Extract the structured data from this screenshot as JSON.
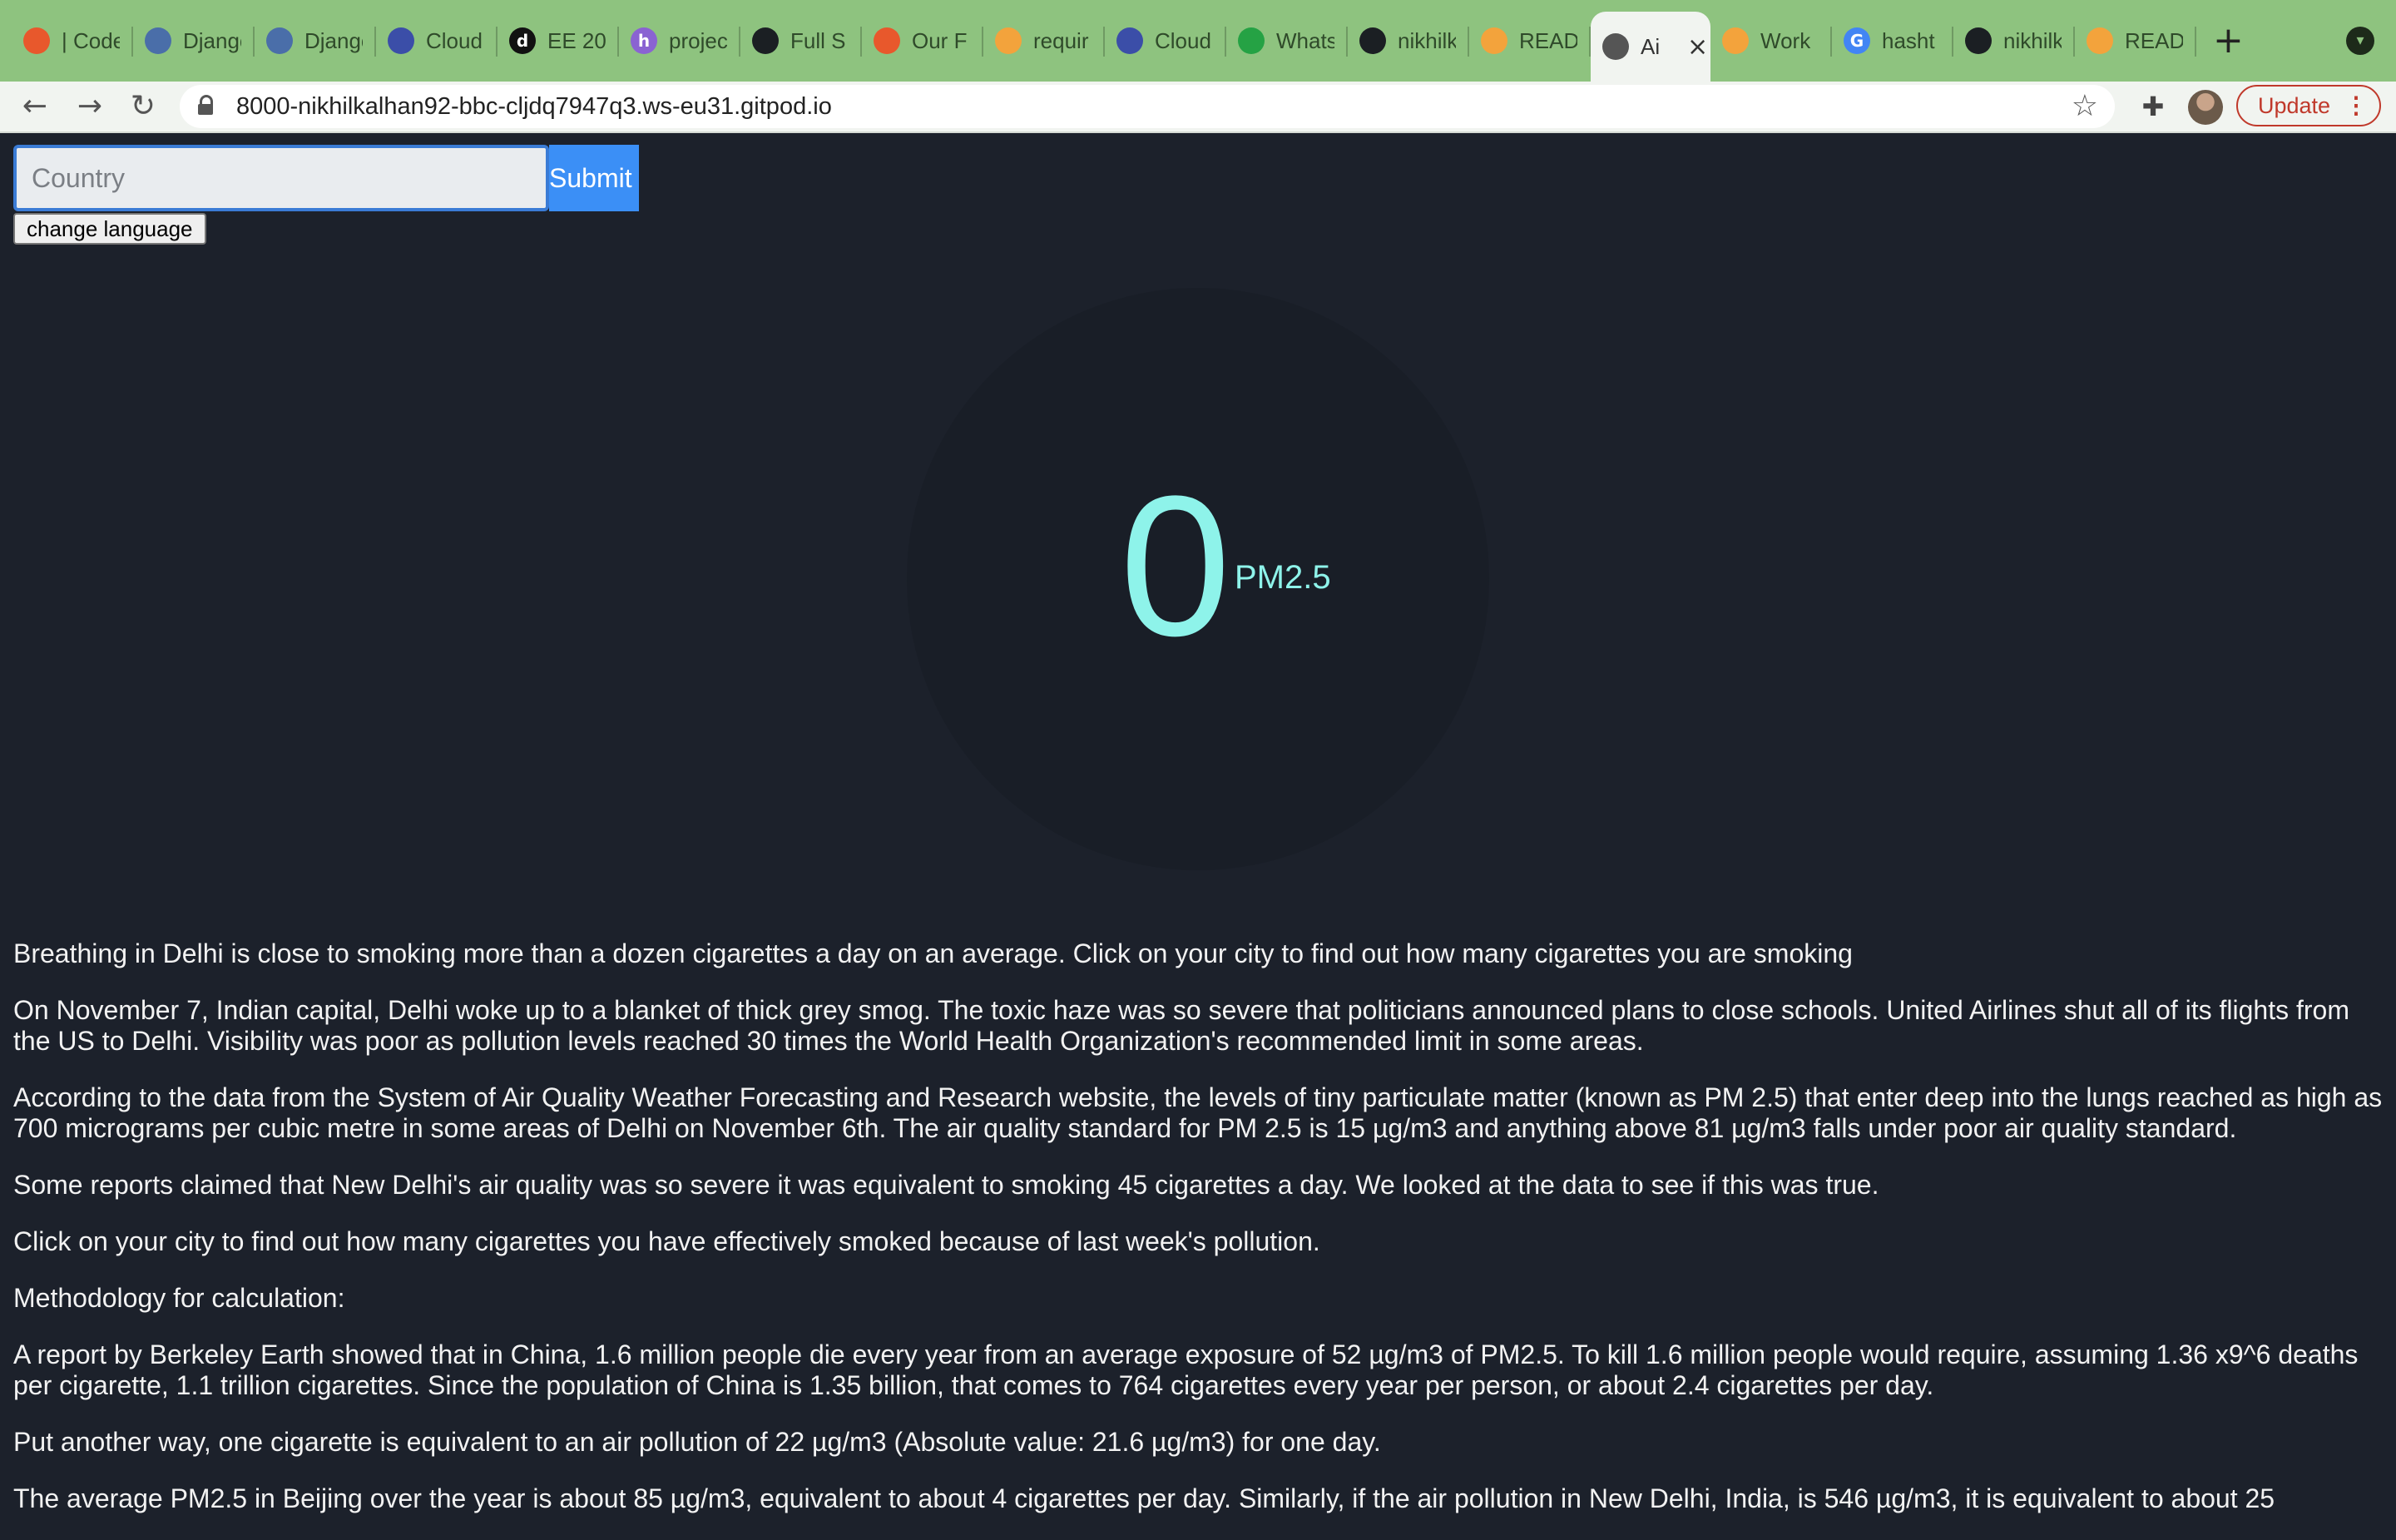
{
  "browser": {
    "tabs": [
      {
        "title": "| Code",
        "icon": "codepen-orange-icon",
        "color": "#e8582c"
      },
      {
        "title": "Django",
        "icon": "django-globe-icon",
        "color": "#4a6ea9"
      },
      {
        "title": "Django",
        "icon": "django-globe-icon",
        "color": "#4a6ea9"
      },
      {
        "title": "Cloud",
        "icon": "cloud-icon",
        "color": "#3b4ea8"
      },
      {
        "title": "EE 20",
        "icon": "d-logo-icon",
        "color": "#111111"
      },
      {
        "title": "projec",
        "icon": "h-logo-icon",
        "color": "#8a63d2"
      },
      {
        "title": "Full S",
        "icon": "github-icon",
        "color": "#1b1f23"
      },
      {
        "title": "Our F",
        "icon": "ring-orange-icon",
        "color": "#e8582c"
      },
      {
        "title": "requir",
        "icon": "gitpod-icon",
        "color": "#f3a33c"
      },
      {
        "title": "Cloud",
        "icon": "cloud-icon",
        "color": "#3b4ea8"
      },
      {
        "title": "Whats",
        "icon": "whatsapp-icon",
        "color": "#25a244"
      },
      {
        "title": "nikhilk",
        "icon": "github-icon",
        "color": "#1b1f23"
      },
      {
        "title": "READ",
        "icon": "gitpod-icon",
        "color": "#f3a33c"
      },
      {
        "title": "Ai",
        "icon": "globe-icon",
        "color": "#555555",
        "active": true
      },
      {
        "title": "Work",
        "icon": "gitpod-icon",
        "color": "#f3a33c"
      },
      {
        "title": "hasht",
        "icon": "google-icon",
        "color": "#4285f4"
      },
      {
        "title": "nikhilk",
        "icon": "github-icon",
        "color": "#1b1f23"
      },
      {
        "title": "READ",
        "icon": "gitpod-icon",
        "color": "#f3a33c"
      }
    ],
    "url": "8000-nikhilkalhan92-bbc-cljdq7947q3.ws-eu31.gitpod.io",
    "update_label": "Update"
  },
  "form": {
    "country_placeholder": "Country",
    "country_value": "",
    "submit_label": "Submit",
    "change_language_label": "change language"
  },
  "gauge": {
    "value": "0",
    "unit": "PM2.5"
  },
  "article": {
    "paragraphs": [
      "Breathing in Delhi is close to smoking more than a dozen cigarettes a day on an average. Click on your city to find out how many cigarettes you are smoking",
      "On November 7, Indian capital, Delhi woke up to a blanket of thick grey smog. The toxic haze was so severe that politicians announced plans to close schools. United Airlines shut all of its flights from the US to Delhi. Visibility was poor as pollution levels reached 30 times the World Health Organization's recommended limit in some areas.",
      "According to the data from the System of Air Quality Weather Forecasting and Research website, the levels of tiny particulate matter (known as PM 2.5) that enter deep into the lungs reached as high as 700 micrograms per cubic metre in some areas of Delhi on November 6th. The air quality standard for PM 2.5 is 15 µg/m3 and anything above 81 µg/m3 falls under poor air quality standard.",
      "Some reports claimed that New Delhi's air quality was so severe it was equivalent to smoking 45 cigarettes a day. We looked at the data to see if this was true.",
      "Click on your city to find out how many cigarettes you have effectively smoked because of last week's pollution.",
      "Methodology for calculation:",
      "A report by Berkeley Earth showed that in China, 1.6 million people die every year from an average exposure of 52 µg/m3 of PM2.5. To kill 1.6 million people would require, assuming 1.36 x9^6 deaths per cigarette, 1.1 trillion cigarettes. Since the population of China is 1.35 billion, that comes to 764 cigarettes every year per person, or about 2.4 cigarettes per day.",
      "Put another way, one cigarette is equivalent to an air pollution of 22 µg/m3 (Absolute value: 21.6 µg/m3) for one day.",
      "The average PM2.5 in Beijing over the year is about 85 µg/m3, equivalent to about 4 cigarettes per day. Similarly, if the air pollution in New Delhi, India, is 546 µg/m3, it is equivalent to about 25"
    ]
  }
}
